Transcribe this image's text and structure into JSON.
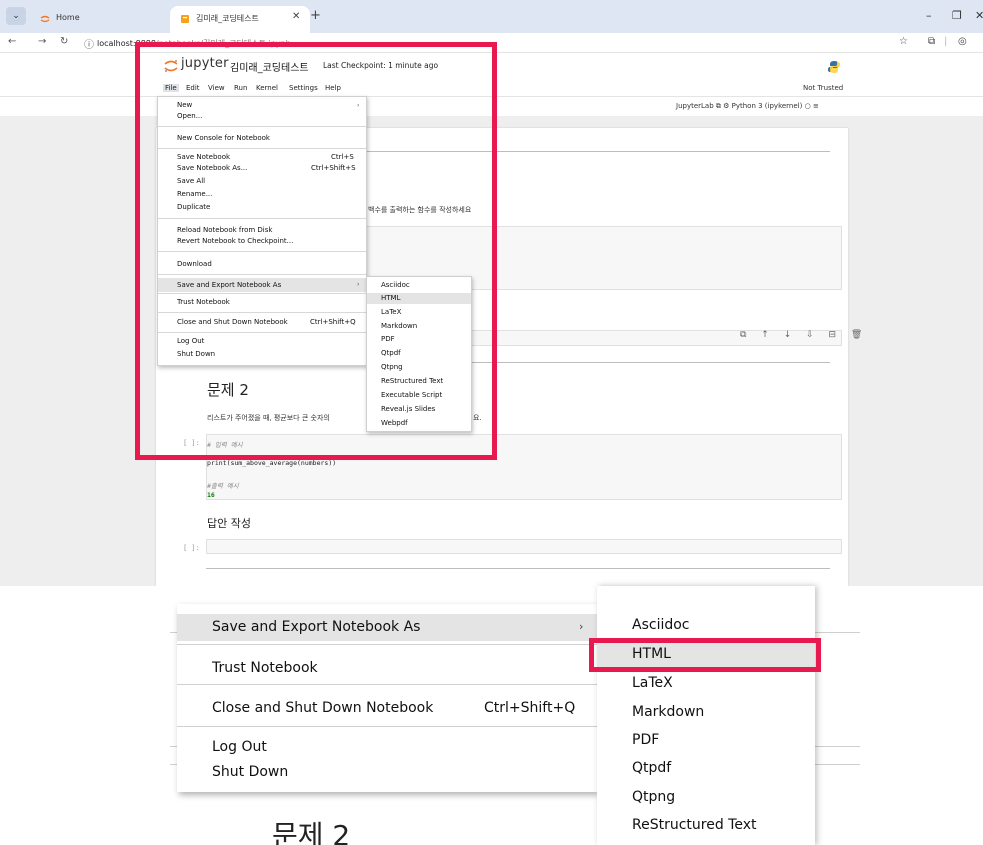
{
  "browser": {
    "tabs": [
      {
        "title": "Home",
        "active": false
      },
      {
        "title": "김미래_코딩테스트",
        "active": true
      }
    ],
    "url_host": "localhost:8888",
    "url_path": "/notebooks/김미래_코딩테스트.ipynb",
    "window_controls": [
      "–",
      "❐",
      "✕"
    ]
  },
  "jupyter": {
    "brand": "jupyter",
    "notebook_title": "김미래_코딩테스트",
    "checkpoint": "Last Checkpoint: 1 minute ago",
    "menus": [
      "File",
      "Edit",
      "View",
      "Run",
      "Kernel",
      "Settings",
      "Help"
    ],
    "trust_status": "Not Trusted",
    "jupyterlab_label": "JupyterLab",
    "kernel": "Python 3 (ipykernel)"
  },
  "file_menu": {
    "items": [
      {
        "label": "New",
        "shortcut": "",
        "submenu": true
      },
      {
        "label": "Open...",
        "shortcut": ""
      },
      {
        "sep": true
      },
      {
        "label": "New Console for Notebook",
        "shortcut": ""
      },
      {
        "sep": true
      },
      {
        "label": "Save Notebook",
        "shortcut": "Ctrl+S"
      },
      {
        "label": "Save Notebook As...",
        "shortcut": "Ctrl+Shift+S"
      },
      {
        "label": "Save All",
        "shortcut": ""
      },
      {
        "label": "Rename...",
        "shortcut": ""
      },
      {
        "label": "Duplicate",
        "shortcut": ""
      },
      {
        "sep": true
      },
      {
        "label": "Reload Notebook from Disk",
        "shortcut": ""
      },
      {
        "label": "Revert Notebook to Checkpoint...",
        "shortcut": ""
      },
      {
        "sep": true
      },
      {
        "label": "Download",
        "shortcut": ""
      },
      {
        "sep": true
      },
      {
        "label": "Save and Export Notebook As",
        "shortcut": "",
        "submenu": true,
        "highlighted": true
      },
      {
        "sep": true
      },
      {
        "label": "Trust Notebook",
        "shortcut": ""
      },
      {
        "sep": true
      },
      {
        "label": "Close and Shut Down Notebook",
        "shortcut": "Ctrl+Shift+Q"
      },
      {
        "sep": true
      },
      {
        "label": "Log Out",
        "shortcut": ""
      },
      {
        "label": "Shut Down",
        "shortcut": ""
      }
    ]
  },
  "export_submenu": {
    "items": [
      "Asciidoc",
      "HTML",
      "LaTeX",
      "Markdown",
      "PDF",
      "Qtpdf",
      "Qtpng",
      "ReStructured Text",
      "Executable Script",
      "Reveal.js Slides",
      "Webpdf"
    ],
    "highlighted": "HTML"
  },
  "notebook": {
    "partial_text_1": "백수를 출력하는 함수를 작성하세요",
    "heading_2": "문제 2",
    "problem_2_text": "리스트가 주어졌을 때, 평균보다 큰 숫자의",
    "problem_2_tail": "요.",
    "prompt_empty": "[ ]:",
    "code_comment_input": "# 입력 예시",
    "code_print": "print(sum_above_average(numbers))",
    "code_comment_output": "#출력 예시",
    "code_output_value": "16",
    "answer_heading": "답안 작성",
    "cell_toolbar": "⧉ ↑ ↓ ⇩ ⊟ 🗑"
  },
  "inset": {
    "menu_items": [
      {
        "label": "Save and Export Notebook As",
        "shortcut": "",
        "submenu": true,
        "highlighted": true
      },
      {
        "label": "Trust Notebook",
        "shortcut": ""
      },
      {
        "label": "Close and Shut Down Notebook",
        "shortcut": "Ctrl+Shift+Q"
      },
      {
        "label": "Log Out",
        "shortcut": ""
      },
      {
        "label": "Shut Down",
        "shortcut": ""
      }
    ],
    "sub_items": [
      "Asciidoc",
      "HTML",
      "LaTeX",
      "Markdown",
      "PDF",
      "Qtpdf",
      "Qtpng",
      "ReStructured Text"
    ],
    "heading_fragment": "문제 2"
  },
  "colors": {
    "highlight_frame": "#e8194f",
    "jupyter_orange": "#f37726"
  }
}
